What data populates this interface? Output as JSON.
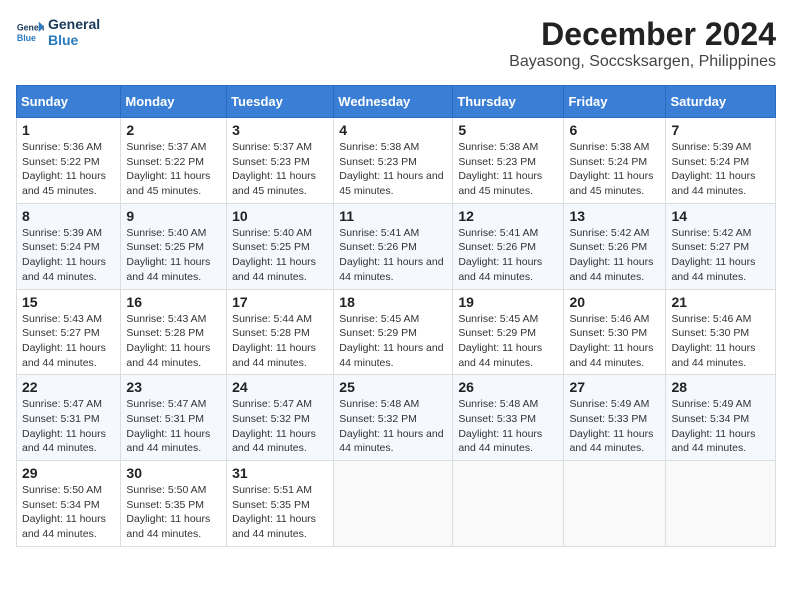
{
  "header": {
    "logo_line1": "General",
    "logo_line2": "Blue",
    "title": "December 2024",
    "subtitle": "Bayasong, Soccsksargen, Philippines"
  },
  "calendar": {
    "days_of_week": [
      "Sunday",
      "Monday",
      "Tuesday",
      "Wednesday",
      "Thursday",
      "Friday",
      "Saturday"
    ],
    "weeks": [
      [
        {
          "day": "1",
          "sunrise": "5:36 AM",
          "sunset": "5:22 PM",
          "daylight": "11 hours and 45 minutes."
        },
        {
          "day": "2",
          "sunrise": "5:37 AM",
          "sunset": "5:22 PM",
          "daylight": "11 hours and 45 minutes."
        },
        {
          "day": "3",
          "sunrise": "5:37 AM",
          "sunset": "5:23 PM",
          "daylight": "11 hours and 45 minutes."
        },
        {
          "day": "4",
          "sunrise": "5:38 AM",
          "sunset": "5:23 PM",
          "daylight": "11 hours and 45 minutes."
        },
        {
          "day": "5",
          "sunrise": "5:38 AM",
          "sunset": "5:23 PM",
          "daylight": "11 hours and 45 minutes."
        },
        {
          "day": "6",
          "sunrise": "5:38 AM",
          "sunset": "5:24 PM",
          "daylight": "11 hours and 45 minutes."
        },
        {
          "day": "7",
          "sunrise": "5:39 AM",
          "sunset": "5:24 PM",
          "daylight": "11 hours and 44 minutes."
        }
      ],
      [
        {
          "day": "8",
          "sunrise": "5:39 AM",
          "sunset": "5:24 PM",
          "daylight": "11 hours and 44 minutes."
        },
        {
          "day": "9",
          "sunrise": "5:40 AM",
          "sunset": "5:25 PM",
          "daylight": "11 hours and 44 minutes."
        },
        {
          "day": "10",
          "sunrise": "5:40 AM",
          "sunset": "5:25 PM",
          "daylight": "11 hours and 44 minutes."
        },
        {
          "day": "11",
          "sunrise": "5:41 AM",
          "sunset": "5:26 PM",
          "daylight": "11 hours and 44 minutes."
        },
        {
          "day": "12",
          "sunrise": "5:41 AM",
          "sunset": "5:26 PM",
          "daylight": "11 hours and 44 minutes."
        },
        {
          "day": "13",
          "sunrise": "5:42 AM",
          "sunset": "5:26 PM",
          "daylight": "11 hours and 44 minutes."
        },
        {
          "day": "14",
          "sunrise": "5:42 AM",
          "sunset": "5:27 PM",
          "daylight": "11 hours and 44 minutes."
        }
      ],
      [
        {
          "day": "15",
          "sunrise": "5:43 AM",
          "sunset": "5:27 PM",
          "daylight": "11 hours and 44 minutes."
        },
        {
          "day": "16",
          "sunrise": "5:43 AM",
          "sunset": "5:28 PM",
          "daylight": "11 hours and 44 minutes."
        },
        {
          "day": "17",
          "sunrise": "5:44 AM",
          "sunset": "5:28 PM",
          "daylight": "11 hours and 44 minutes."
        },
        {
          "day": "18",
          "sunrise": "5:45 AM",
          "sunset": "5:29 PM",
          "daylight": "11 hours and 44 minutes."
        },
        {
          "day": "19",
          "sunrise": "5:45 AM",
          "sunset": "5:29 PM",
          "daylight": "11 hours and 44 minutes."
        },
        {
          "day": "20",
          "sunrise": "5:46 AM",
          "sunset": "5:30 PM",
          "daylight": "11 hours and 44 minutes."
        },
        {
          "day": "21",
          "sunrise": "5:46 AM",
          "sunset": "5:30 PM",
          "daylight": "11 hours and 44 minutes."
        }
      ],
      [
        {
          "day": "22",
          "sunrise": "5:47 AM",
          "sunset": "5:31 PM",
          "daylight": "11 hours and 44 minutes."
        },
        {
          "day": "23",
          "sunrise": "5:47 AM",
          "sunset": "5:31 PM",
          "daylight": "11 hours and 44 minutes."
        },
        {
          "day": "24",
          "sunrise": "5:47 AM",
          "sunset": "5:32 PM",
          "daylight": "11 hours and 44 minutes."
        },
        {
          "day": "25",
          "sunrise": "5:48 AM",
          "sunset": "5:32 PM",
          "daylight": "11 hours and 44 minutes."
        },
        {
          "day": "26",
          "sunrise": "5:48 AM",
          "sunset": "5:33 PM",
          "daylight": "11 hours and 44 minutes."
        },
        {
          "day": "27",
          "sunrise": "5:49 AM",
          "sunset": "5:33 PM",
          "daylight": "11 hours and 44 minutes."
        },
        {
          "day": "28",
          "sunrise": "5:49 AM",
          "sunset": "5:34 PM",
          "daylight": "11 hours and 44 minutes."
        }
      ],
      [
        {
          "day": "29",
          "sunrise": "5:50 AM",
          "sunset": "5:34 PM",
          "daylight": "11 hours and 44 minutes."
        },
        {
          "day": "30",
          "sunrise": "5:50 AM",
          "sunset": "5:35 PM",
          "daylight": "11 hours and 44 minutes."
        },
        {
          "day": "31",
          "sunrise": "5:51 AM",
          "sunset": "5:35 PM",
          "daylight": "11 hours and 44 minutes."
        },
        null,
        null,
        null,
        null
      ]
    ]
  },
  "labels": {
    "sunrise": "Sunrise:",
    "sunset": "Sunset:",
    "daylight": "Daylight:"
  }
}
